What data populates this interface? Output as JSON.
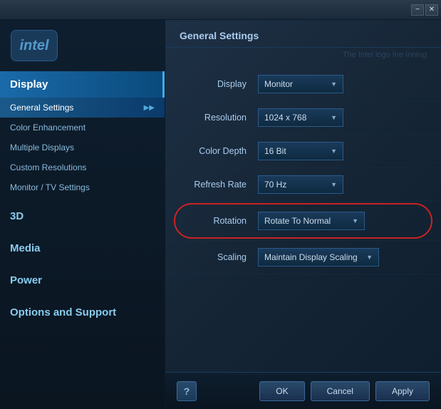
{
  "titlebar": {
    "minimize_label": "−",
    "close_label": "✕"
  },
  "sidebar": {
    "logo_text": "intel",
    "items": [
      {
        "id": "display",
        "label": "Display",
        "type": "main",
        "active": true
      },
      {
        "id": "general-settings",
        "label": "General Settings",
        "type": "sub",
        "active": true,
        "has_arrow": true
      },
      {
        "id": "color-enhancement",
        "label": "Color Enhancement",
        "type": "sub",
        "active": false,
        "has_arrow": false
      },
      {
        "id": "multiple-displays",
        "label": "Multiple Displays",
        "type": "sub",
        "active": false,
        "has_arrow": false
      },
      {
        "id": "custom-resolutions",
        "label": "Custom Resolutions",
        "type": "sub",
        "active": false,
        "has_arrow": false
      },
      {
        "id": "monitor-tv-settings",
        "label": "Monitor / TV Settings",
        "type": "sub",
        "active": false,
        "has_arrow": false
      },
      {
        "id": "3d",
        "label": "3D",
        "type": "main",
        "active": false
      },
      {
        "id": "media",
        "label": "Media",
        "type": "main",
        "active": false
      },
      {
        "id": "power",
        "label": "Power",
        "type": "main",
        "active": false
      },
      {
        "id": "options-support",
        "label": "Options and Support",
        "type": "main",
        "active": false
      }
    ]
  },
  "content": {
    "header": "General Settings",
    "watermark": "The Intel logo Ine Inning",
    "settings": [
      {
        "id": "display",
        "label": "Display",
        "value": "Monitor",
        "has_dropdown": true
      },
      {
        "id": "resolution",
        "label": "Resolution",
        "value": "1024 x 768",
        "has_dropdown": true
      },
      {
        "id": "color-depth",
        "label": "Color Depth",
        "value": "16 Bit",
        "has_dropdown": true
      },
      {
        "id": "refresh-rate",
        "label": "Refresh Rate",
        "value": "70 Hz",
        "has_dropdown": true
      },
      {
        "id": "rotation",
        "label": "Rotation",
        "value": "Rotate To Normal",
        "has_dropdown": true,
        "highlighted": true
      },
      {
        "id": "scaling",
        "label": "Scaling",
        "value": "Maintain Display Scaling",
        "has_dropdown": true,
        "highlighted": false
      }
    ]
  },
  "buttons": {
    "help": "?",
    "ok": "OK",
    "cancel": "Cancel",
    "apply": "Apply"
  }
}
